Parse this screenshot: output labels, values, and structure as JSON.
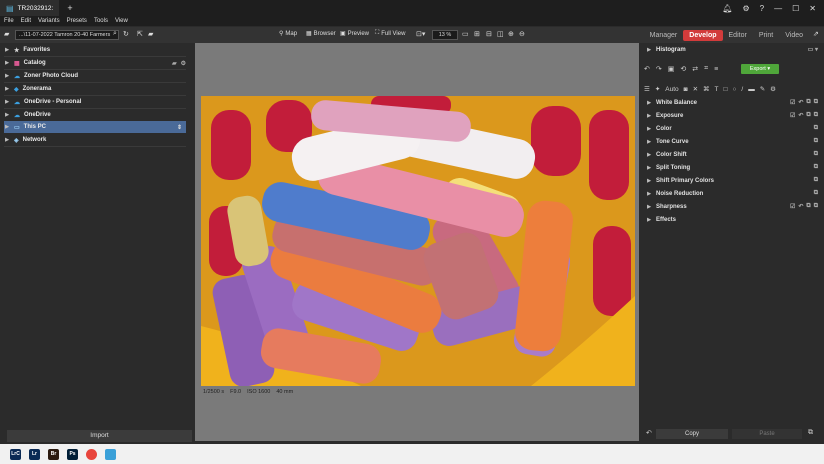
{
  "titlebar": {
    "tab_title": "TR2032912:",
    "add_tab": "+",
    "icons": [
      "bell-icon",
      "gear-icon",
      "help-icon",
      "minimize-icon",
      "maximize-icon",
      "close-icon"
    ]
  },
  "menu": [
    "File",
    "Edit",
    "Variants",
    "Presets",
    "Tools",
    "View"
  ],
  "toolbar": {
    "path": "...\\11-07-2022 Tamron 20-40 Farmers",
    "map_label": "Map",
    "browser_label": "Browser",
    "preview_label": "Preview",
    "fullview_label": "Full View",
    "zoom_value": "13 %"
  },
  "modes": [
    {
      "label": "Manager",
      "active": false
    },
    {
      "label": "Develop",
      "active": true
    },
    {
      "label": "Editor",
      "active": false
    },
    {
      "label": "Print",
      "active": false
    },
    {
      "label": "Video",
      "active": false
    }
  ],
  "sidebar": {
    "items": [
      {
        "label": "Favorites",
        "icon": "star-icon"
      },
      {
        "label": "Catalog",
        "icon": "catalog-icon"
      },
      {
        "label": "Zoner Photo Cloud",
        "icon": "cloud-icon"
      },
      {
        "label": "Zonerama",
        "icon": "zonerama-icon"
      },
      {
        "label": "OneDrive - Personal",
        "icon": "onedrive-icon"
      },
      {
        "label": "OneDrive",
        "icon": "onedrive-icon"
      },
      {
        "label": "This PC",
        "icon": "computer-icon",
        "selected": true
      },
      {
        "label": "Network",
        "icon": "network-icon"
      }
    ],
    "import_label": "Import"
  },
  "preview": {
    "exif": [
      "1/2500 s",
      "F9.0",
      "ISO 1600",
      "40 mm"
    ]
  },
  "right": {
    "histogram_label": "Histogram",
    "auto_label": "Auto",
    "export_label": "Export",
    "panels": [
      {
        "label": "White Balance",
        "checked": true
      },
      {
        "label": "Exposure",
        "checked": true
      },
      {
        "label": "Color",
        "checked": false
      },
      {
        "label": "Tone Curve",
        "checked": false
      },
      {
        "label": "Color Shift",
        "checked": false
      },
      {
        "label": "Split Toning",
        "checked": false
      },
      {
        "label": "Shift Primary Colors",
        "checked": false
      },
      {
        "label": "Noise Reduction",
        "checked": false
      },
      {
        "label": "Sharpness",
        "checked": true
      },
      {
        "label": "Effects",
        "checked": false
      }
    ],
    "copy_label": "Copy",
    "paste_label": "Paste"
  },
  "taskbar": [
    {
      "label": "LrC",
      "color": "#0a2a55"
    },
    {
      "label": "Lr",
      "color": "#0a2a55"
    },
    {
      "label": "Br",
      "color": "#2b1a0f"
    },
    {
      "label": "Ps",
      "color": "#001e36"
    },
    {
      "label": "",
      "color": "#e8453c"
    },
    {
      "label": "",
      "color": "#3aa0d8"
    }
  ],
  "colors": {
    "accent": "#d23b3b",
    "selection": "#4a6a98",
    "export_green": "#4fa63a"
  }
}
